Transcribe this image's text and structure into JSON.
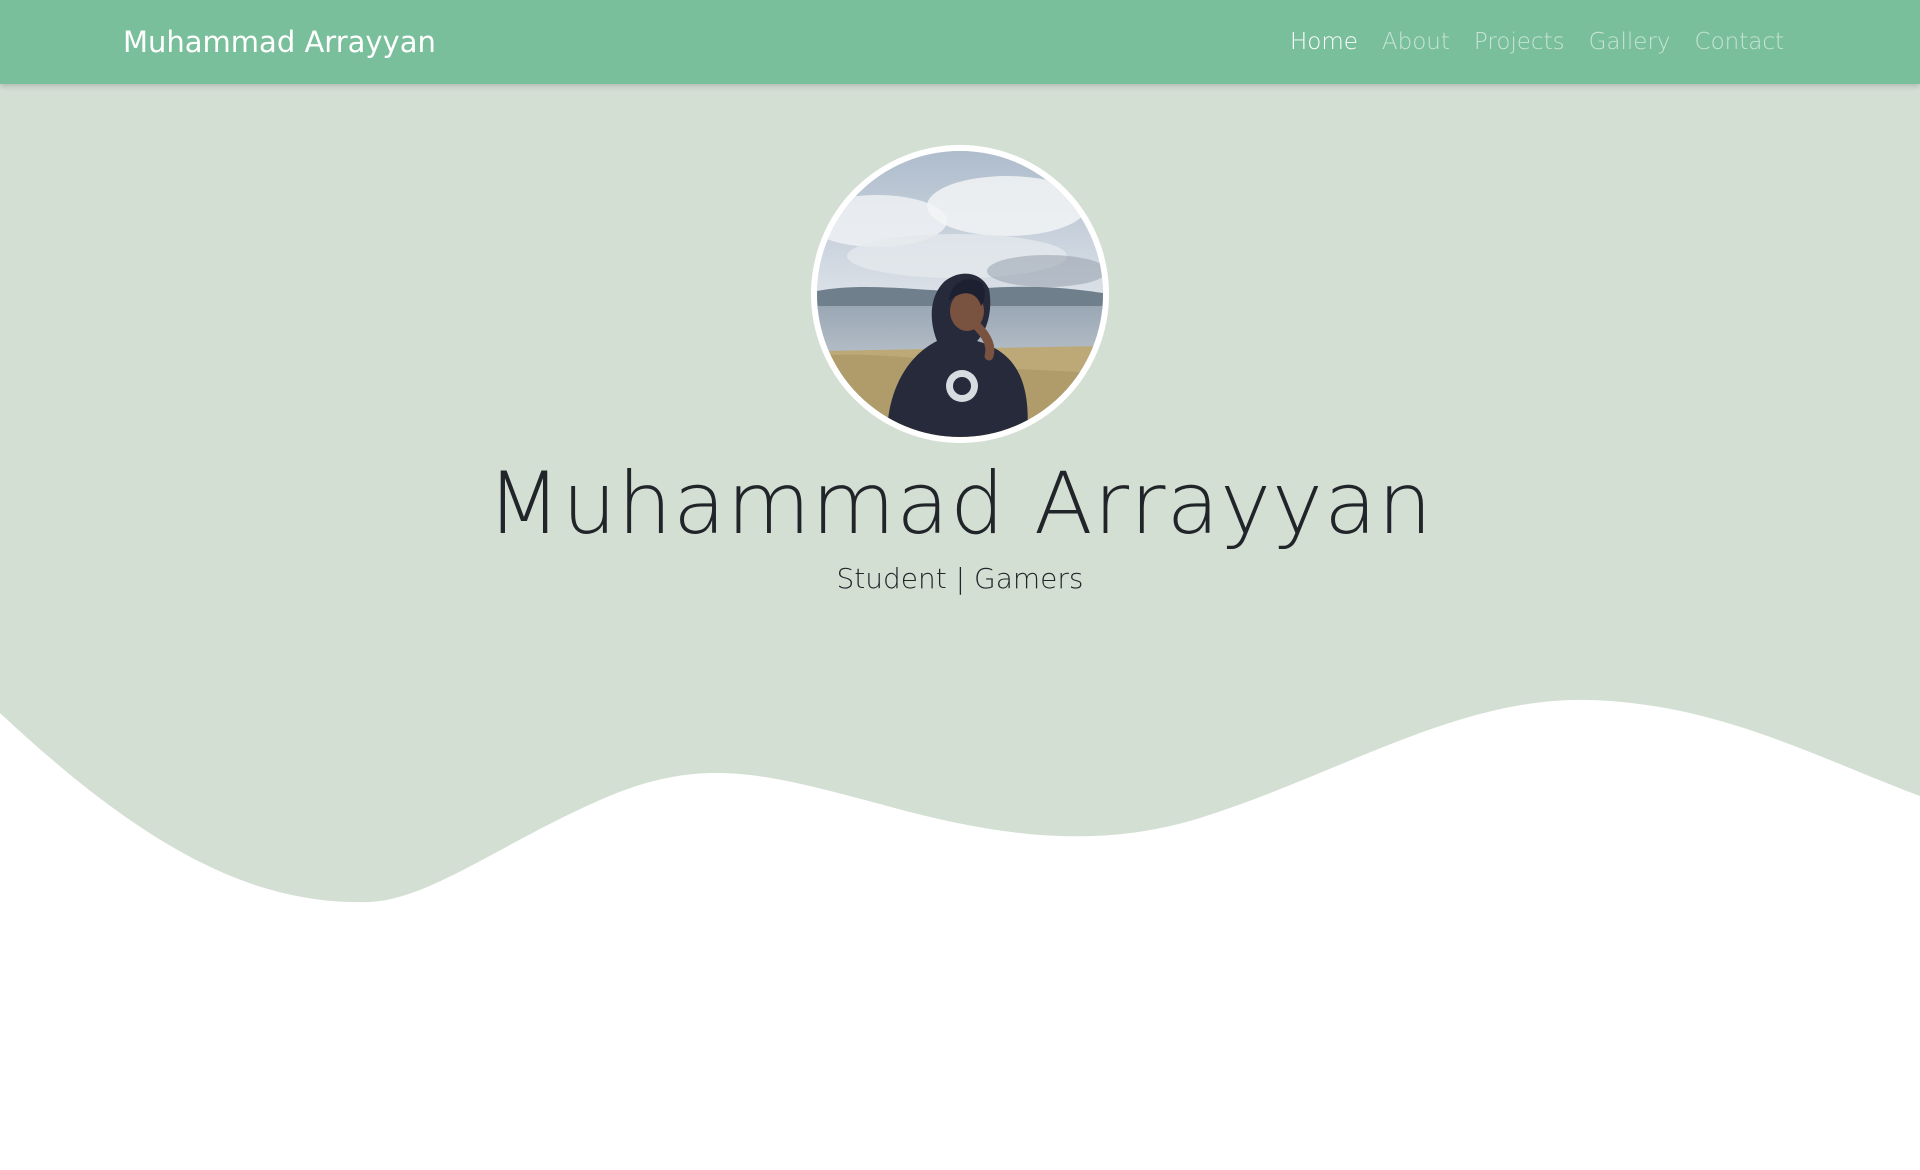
{
  "navbar": {
    "brand": "Muhammad Arrayyan",
    "links": [
      {
        "label": "Home",
        "active": true
      },
      {
        "label": "About",
        "active": false
      },
      {
        "label": "Projects",
        "active": false
      },
      {
        "label": "Gallery",
        "active": false
      },
      {
        "label": "Contact",
        "active": false
      }
    ]
  },
  "hero": {
    "title": "Muhammad Arrayyan",
    "subtitle_left": "Student",
    "subtitle_separator": "|",
    "subtitle_right": "Gamers"
  },
  "colors": {
    "navbar_bg": "#7abf9b",
    "hero_bg": "#d4dfd4",
    "page_bg": "#ffffff",
    "text": "#212529"
  }
}
